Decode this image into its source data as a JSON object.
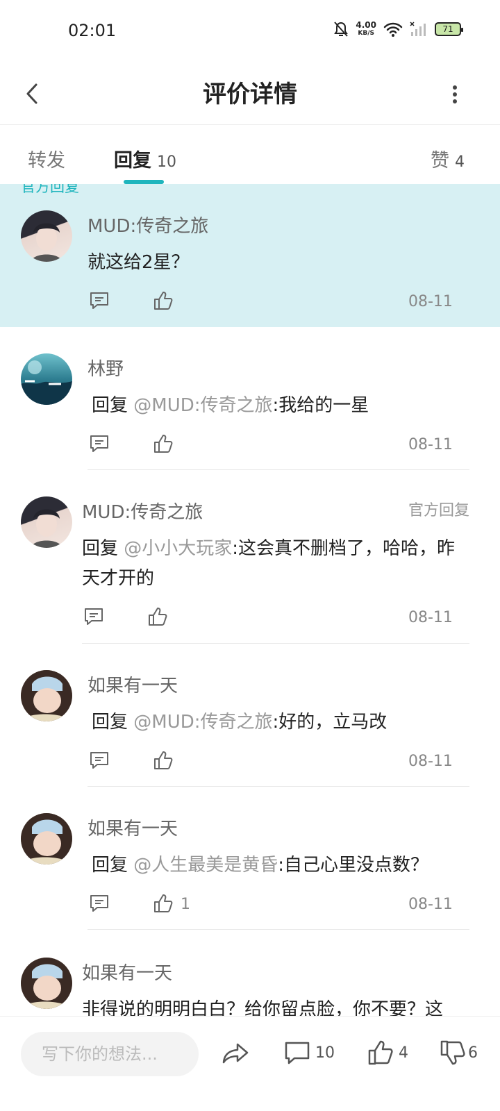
{
  "status": {
    "time": "02:01",
    "speed_value": "4.00",
    "speed_unit": "KB/S",
    "battery": "71"
  },
  "nav": {
    "title": "评价详情"
  },
  "tabs": [
    {
      "label": "转发",
      "count": ""
    },
    {
      "label": "回复",
      "count": "10"
    },
    {
      "label": "赞",
      "count": "4"
    }
  ],
  "cut_label": "官方回复",
  "comments": [
    {
      "user": "MUD:传奇之旅",
      "badge": "",
      "prefix": "",
      "mention": "",
      "text": "就这给2星？",
      "likes": "",
      "date": "08-11"
    },
    {
      "user": "林野",
      "badge": "",
      "prefix": "回复 ",
      "mention": "@MUD:传奇之旅",
      "text": ":我给的一星",
      "likes": "",
      "date": "08-11"
    },
    {
      "user": "MUD:传奇之旅",
      "badge": "官方回复",
      "prefix": "回复 ",
      "mention": "@小小大玩家",
      "text": ":这会真不删档了，哈哈，昨天才开的",
      "likes": "",
      "date": "08-11"
    },
    {
      "user": "如果有一天",
      "badge": "",
      "prefix": "回复 ",
      "mention": "@MUD:传奇之旅",
      "text": ":好的，立马改",
      "likes": "",
      "date": "08-11"
    },
    {
      "user": "如果有一天",
      "badge": "",
      "prefix": "回复 ",
      "mention": "@人生最美是黄昏",
      "text": ":自己心里没点数？",
      "likes": "1",
      "date": "08-11"
    },
    {
      "user": "如果有一天",
      "badge": "",
      "prefix": "",
      "mention": "",
      "text": "非得说的明明白白？给你留点脸，你不要？这",
      "likes": "",
      "date": ""
    }
  ],
  "bottom": {
    "placeholder": "写下你的想法...",
    "comment_count": "10",
    "like_count": "4",
    "dislike_count": "6"
  },
  "colors": {
    "accent": "#1fb5bd",
    "highlight_bg": "#d7f0f3"
  }
}
